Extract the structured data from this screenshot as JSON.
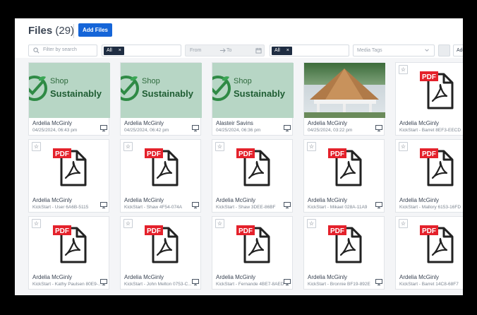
{
  "header": {
    "title": "Files",
    "count": "(29)",
    "add_files_label": "Add Files"
  },
  "filters": {
    "search_placeholder": "Filter by search",
    "type_chip": "All",
    "type_chip_x": "×",
    "date_from": "From",
    "date_to": "To",
    "status_chip": "All",
    "status_chip_x": "×",
    "media_tags_placeholder": "Media Tags",
    "add_filter_label": "Add"
  },
  "cards": [
    {
      "thumb": "sustainably",
      "name": "Ardelia McGinly",
      "sub": "04/25/2024, 06:43 pm"
    },
    {
      "thumb": "sustainably",
      "name": "Ardelia McGinly",
      "sub": "04/25/2024, 06:42 pm"
    },
    {
      "thumb": "sustainably",
      "name": "Alasteir Savins",
      "sub": "04/25/2024, 06:36 pm"
    },
    {
      "thumb": "photo",
      "name": "Ardelia McGinly",
      "sub": "04/25/2024, 03:22 pm"
    },
    {
      "thumb": "pdf",
      "name": "Ardelia McGinly",
      "sub": "KickStart - Barret 8EF3-EECD"
    },
    {
      "thumb": "pdf",
      "name": "Ardelia McGinly",
      "sub": "KickStart - User 6A6B-5115"
    },
    {
      "thumb": "pdf",
      "name": "Ardelia McGinly",
      "sub": "KickStart - Shaw 4F54-074A"
    },
    {
      "thumb": "pdf",
      "name": "Ardelia McGinly",
      "sub": "KickStart - Shaw 3DEE-86BF"
    },
    {
      "thumb": "pdf",
      "name": "Ardelia McGinly",
      "sub": "KickStart - Mikael 028A-11A9"
    },
    {
      "thumb": "pdf",
      "name": "Ardelia McGinly",
      "sub": "KickStart - Mallory 6153-16FD"
    },
    {
      "thumb": "pdf",
      "name": "Ardelia McGinly",
      "sub": "KickStart - Kathy Paulsen 80E9-..."
    },
    {
      "thumb": "pdf",
      "name": "Ardelia McGinly",
      "sub": "KickStart - John Melton 0753-C..."
    },
    {
      "thumb": "pdf",
      "name": "Ardelia McGinly",
      "sub": "KickStart - Fernande 4BE7-8AED"
    },
    {
      "thumb": "pdf",
      "name": "Ardelia McGinly",
      "sub": "KickStart - Bronnie BF19-892E"
    },
    {
      "thumb": "pdf",
      "name": "Ardelia McGinly",
      "sub": "KickStart - Barret 14C8-68F7"
    }
  ],
  "thumb_text": {
    "shop": "Shop",
    "sustainably": "Sustainably",
    "pdf": "PDF",
    "star": "☆"
  },
  "colors": {
    "brand": "#1565d8",
    "chip": "#1f2d42",
    "pdf_red": "#e4212b"
  }
}
